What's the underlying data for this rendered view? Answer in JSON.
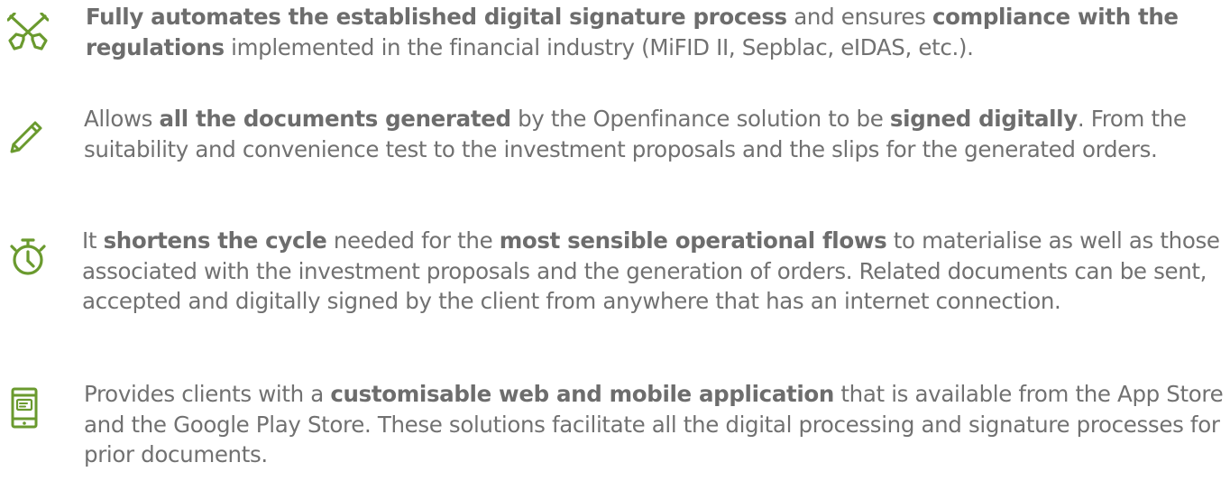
{
  "accent_color": "#6a9a2e",
  "text_color": "#717171",
  "features": [
    {
      "icon": "crossed-paddles-icon",
      "segments": [
        {
          "t": "Fully automates the established digital signature process",
          "b": true
        },
        {
          "t": " and ensures ",
          "b": false
        },
        {
          "t": "compliance with the regulations",
          "b": true
        },
        {
          "t": " implemented in the financial industry (MiFID II, Sepblac, eIDAS, etc.).",
          "b": false
        }
      ]
    },
    {
      "icon": "pencil-icon",
      "segments": [
        {
          "t": "Allows ",
          "b": false
        },
        {
          "t": "all the documents generated",
          "b": true
        },
        {
          "t": " by the Openfinance solution to be ",
          "b": false
        },
        {
          "t": "signed digitally",
          "b": true
        },
        {
          "t": ". From the suitability and convenience test to the investment proposals and the slips for the generated orders.",
          "b": false
        }
      ]
    },
    {
      "icon": "stopwatch-icon",
      "segments": [
        {
          "t": "It ",
          "b": false
        },
        {
          "t": "shortens the cycle",
          "b": true
        },
        {
          "t": " needed for the ",
          "b": false
        },
        {
          "t": "most sensible operational flows",
          "b": true
        },
        {
          "t": " to materialise as well as those associated with the investment proposals and the generation of orders. Related documents can be sent, accepted and digitally signed by the client from anywhere that has an internet connection.",
          "b": false
        }
      ]
    },
    {
      "icon": "mobile-phone-icon",
      "segments": [
        {
          "t": "Provides clients with a ",
          "b": false
        },
        {
          "t": "customisable web and mobile application",
          "b": true
        },
        {
          "t": " that is available from the App Store and the Google Play Store. These solutions facilitate all the digital processing and signature processes for prior documents.",
          "b": false
        }
      ]
    }
  ]
}
